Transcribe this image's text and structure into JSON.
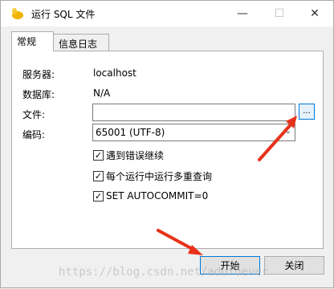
{
  "window": {
    "title": "运行 SQL 文件",
    "min_symbol": "—",
    "max_symbol": "☐",
    "close_symbol": "✕"
  },
  "tabs": [
    {
      "label": "常规",
      "active": true
    },
    {
      "label": "信息日志",
      "active": false
    }
  ],
  "fields": {
    "server_label": "服务器:",
    "server_value": "localhost",
    "database_label": "数据库:",
    "database_value": "N/A",
    "file_label": "文件:",
    "file_value": "",
    "browse_label": "...",
    "encoding_label": "编码:",
    "encoding_value": "65001 (UTF-8)"
  },
  "options": [
    {
      "label": "遇到错误继续",
      "checked": true
    },
    {
      "label": "每个运行中运行多重查询",
      "checked": true
    },
    {
      "label": "SET AUTOCOMMIT=0",
      "checked": true
    }
  ],
  "buttons": {
    "start": "开始",
    "close": "关闭"
  },
  "watermark": "https://blog.csdn.net/adufoever",
  "colors": {
    "accent": "#0078d7",
    "arrow": "#e8311a",
    "app_icon": "#f0b400"
  },
  "check_symbol": "✓"
}
